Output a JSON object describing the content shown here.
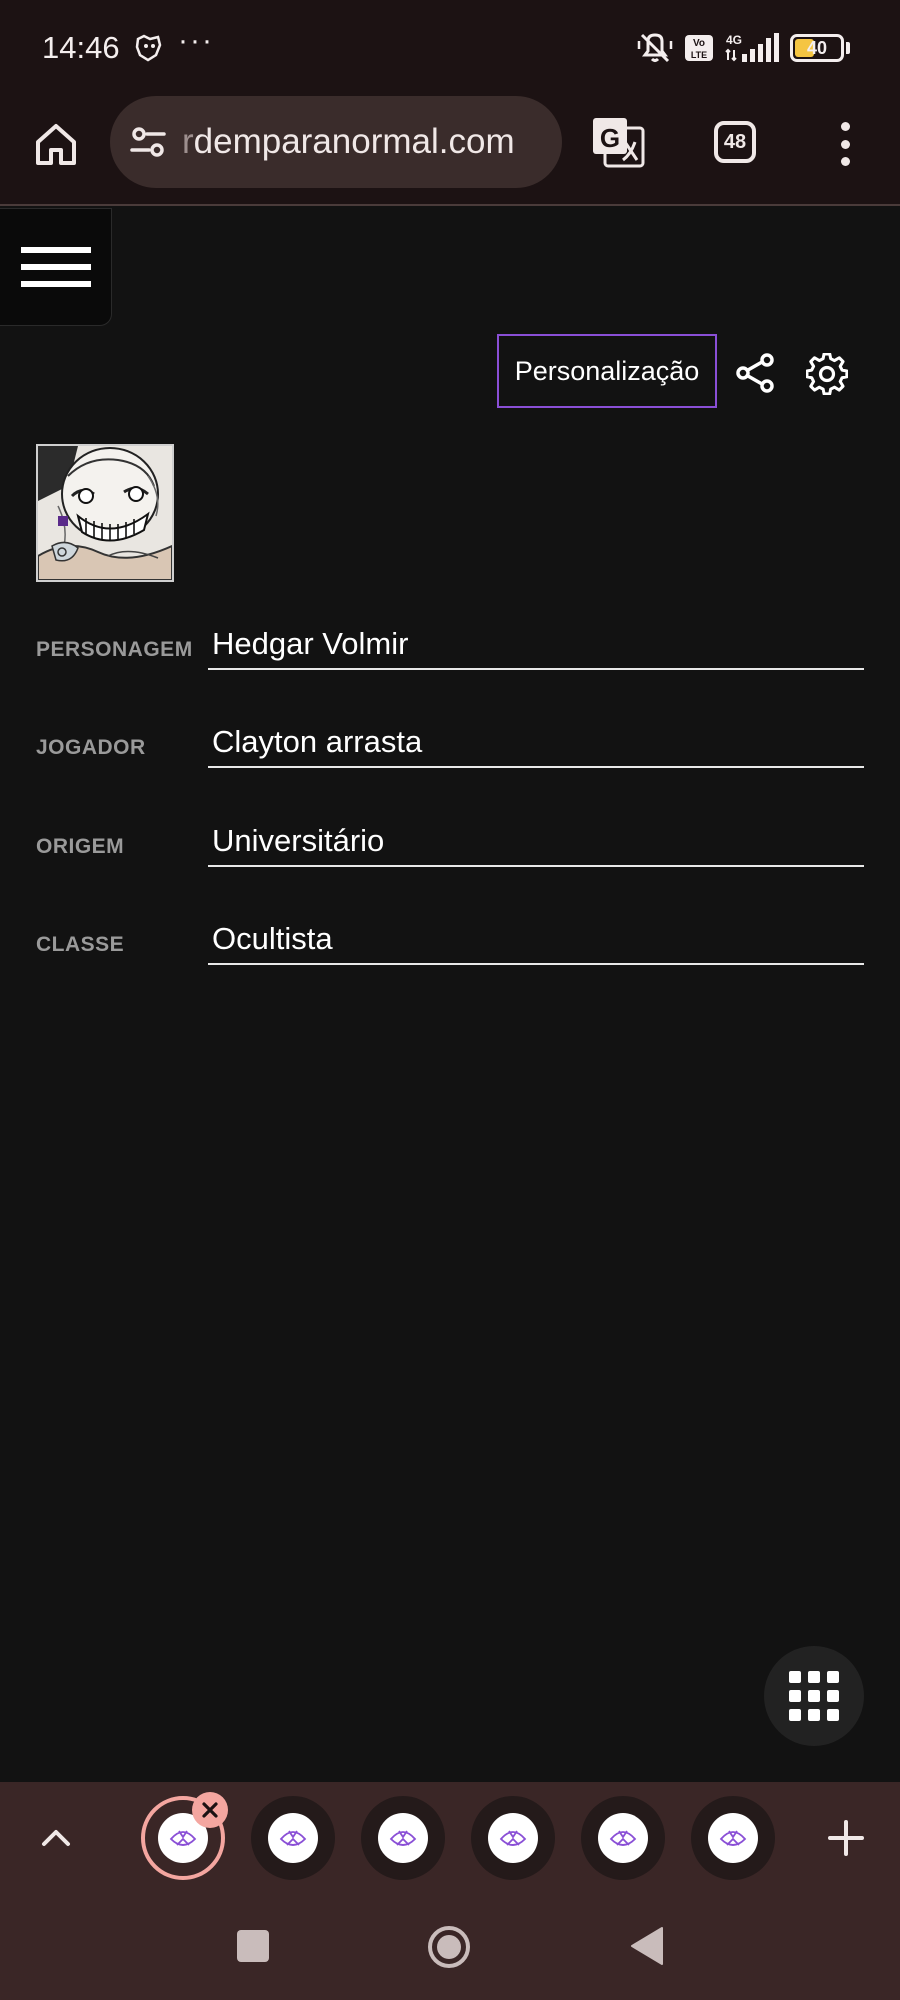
{
  "status_bar": {
    "time": "14:46",
    "dots": "···",
    "volte_label": "Vo LTE",
    "network": "4G",
    "battery": "40",
    "battery_level": 0.4
  },
  "browser": {
    "url_faded": "r",
    "url": "demparanormal.com",
    "tab_count": "48",
    "icons": [
      "home-icon",
      "site-settings-icon",
      "translate-icon",
      "tabs-icon",
      "more-vert-icon"
    ]
  },
  "page": {
    "personalize_label": "Personalização",
    "fields": [
      {
        "label": "PERSONAGEM",
        "value": "Hedgar Volmir"
      },
      {
        "label": "JOGADOR",
        "value": "Clayton arrasta"
      },
      {
        "label": "ORIGEM",
        "value": "Universitário"
      },
      {
        "label": "CLASSE",
        "value": "Ocultista"
      }
    ]
  },
  "colors": {
    "background": "#121212",
    "accent_border": "#8a4fd6",
    "chrome": "#1c1213",
    "tab_strip": "#3a2626",
    "active_tab_ring": "#f4a6a0"
  }
}
